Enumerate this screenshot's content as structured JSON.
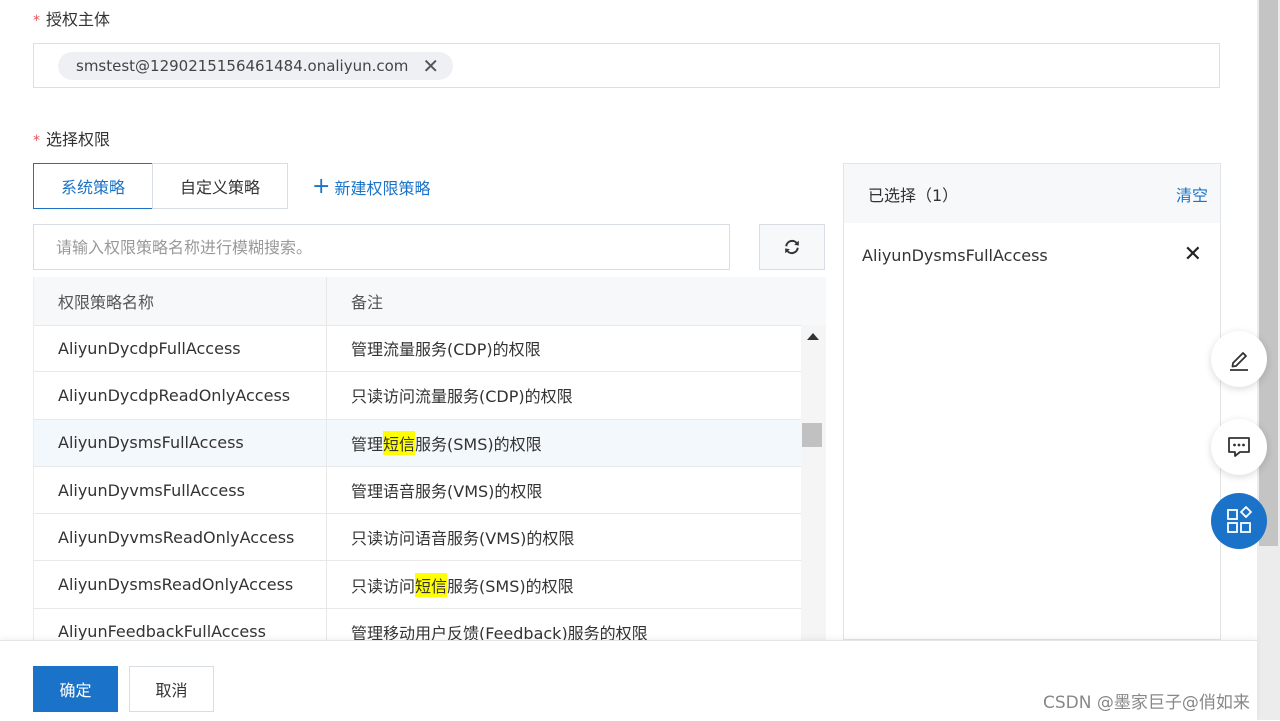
{
  "principal": {
    "label": "授权主体",
    "tag": "smstest@1290215156461484.onaliyun.com"
  },
  "permissions": {
    "label": "选择权限",
    "tabs": [
      "系统策略",
      "自定义策略"
    ],
    "new_policy": "新建权限策略",
    "search_placeholder": "请输入权限策略名称进行模糊搜索。"
  },
  "table": {
    "headers": [
      "权限策略名称",
      "备注"
    ],
    "rows": [
      {
        "name": "AliyunDycdpFullAccess",
        "note_pre": "管理流量服务(CDP)的权限",
        "note_hl": "",
        "note_post": ""
      },
      {
        "name": "AliyunDycdpReadOnlyAccess",
        "note_pre": "只读访问流量服务(CDP)的权限",
        "note_hl": "",
        "note_post": ""
      },
      {
        "name": "AliyunDysmsFullAccess",
        "note_pre": "管理",
        "note_hl": "短信",
        "note_post": "服务(SMS)的权限"
      },
      {
        "name": "AliyunDyvmsFullAccess",
        "note_pre": "管理语音服务(VMS)的权限",
        "note_hl": "",
        "note_post": ""
      },
      {
        "name": "AliyunDyvmsReadOnlyAccess",
        "note_pre": "只读访问语音服务(VMS)的权限",
        "note_hl": "",
        "note_post": ""
      },
      {
        "name": "AliyunDysmsReadOnlyAccess",
        "note_pre": "只读访问",
        "note_hl": "短信",
        "note_post": "服务(SMS)的权限"
      },
      {
        "name": "AliyunFeedbackFullAccess",
        "note_pre": "管理移动用户反馈(Feedback)服务的权限",
        "note_hl": "",
        "note_post": ""
      }
    ]
  },
  "selected": {
    "title": "已选择（1）",
    "clear": "清空",
    "items": [
      "AliyunDysmsFullAccess"
    ]
  },
  "footer": {
    "ok": "确定",
    "cancel": "取消"
  },
  "watermark": "CSDN @墨家巨子@俏如来",
  "colors": {
    "accent": "#1a73c8",
    "highlight": "#ffff00"
  }
}
